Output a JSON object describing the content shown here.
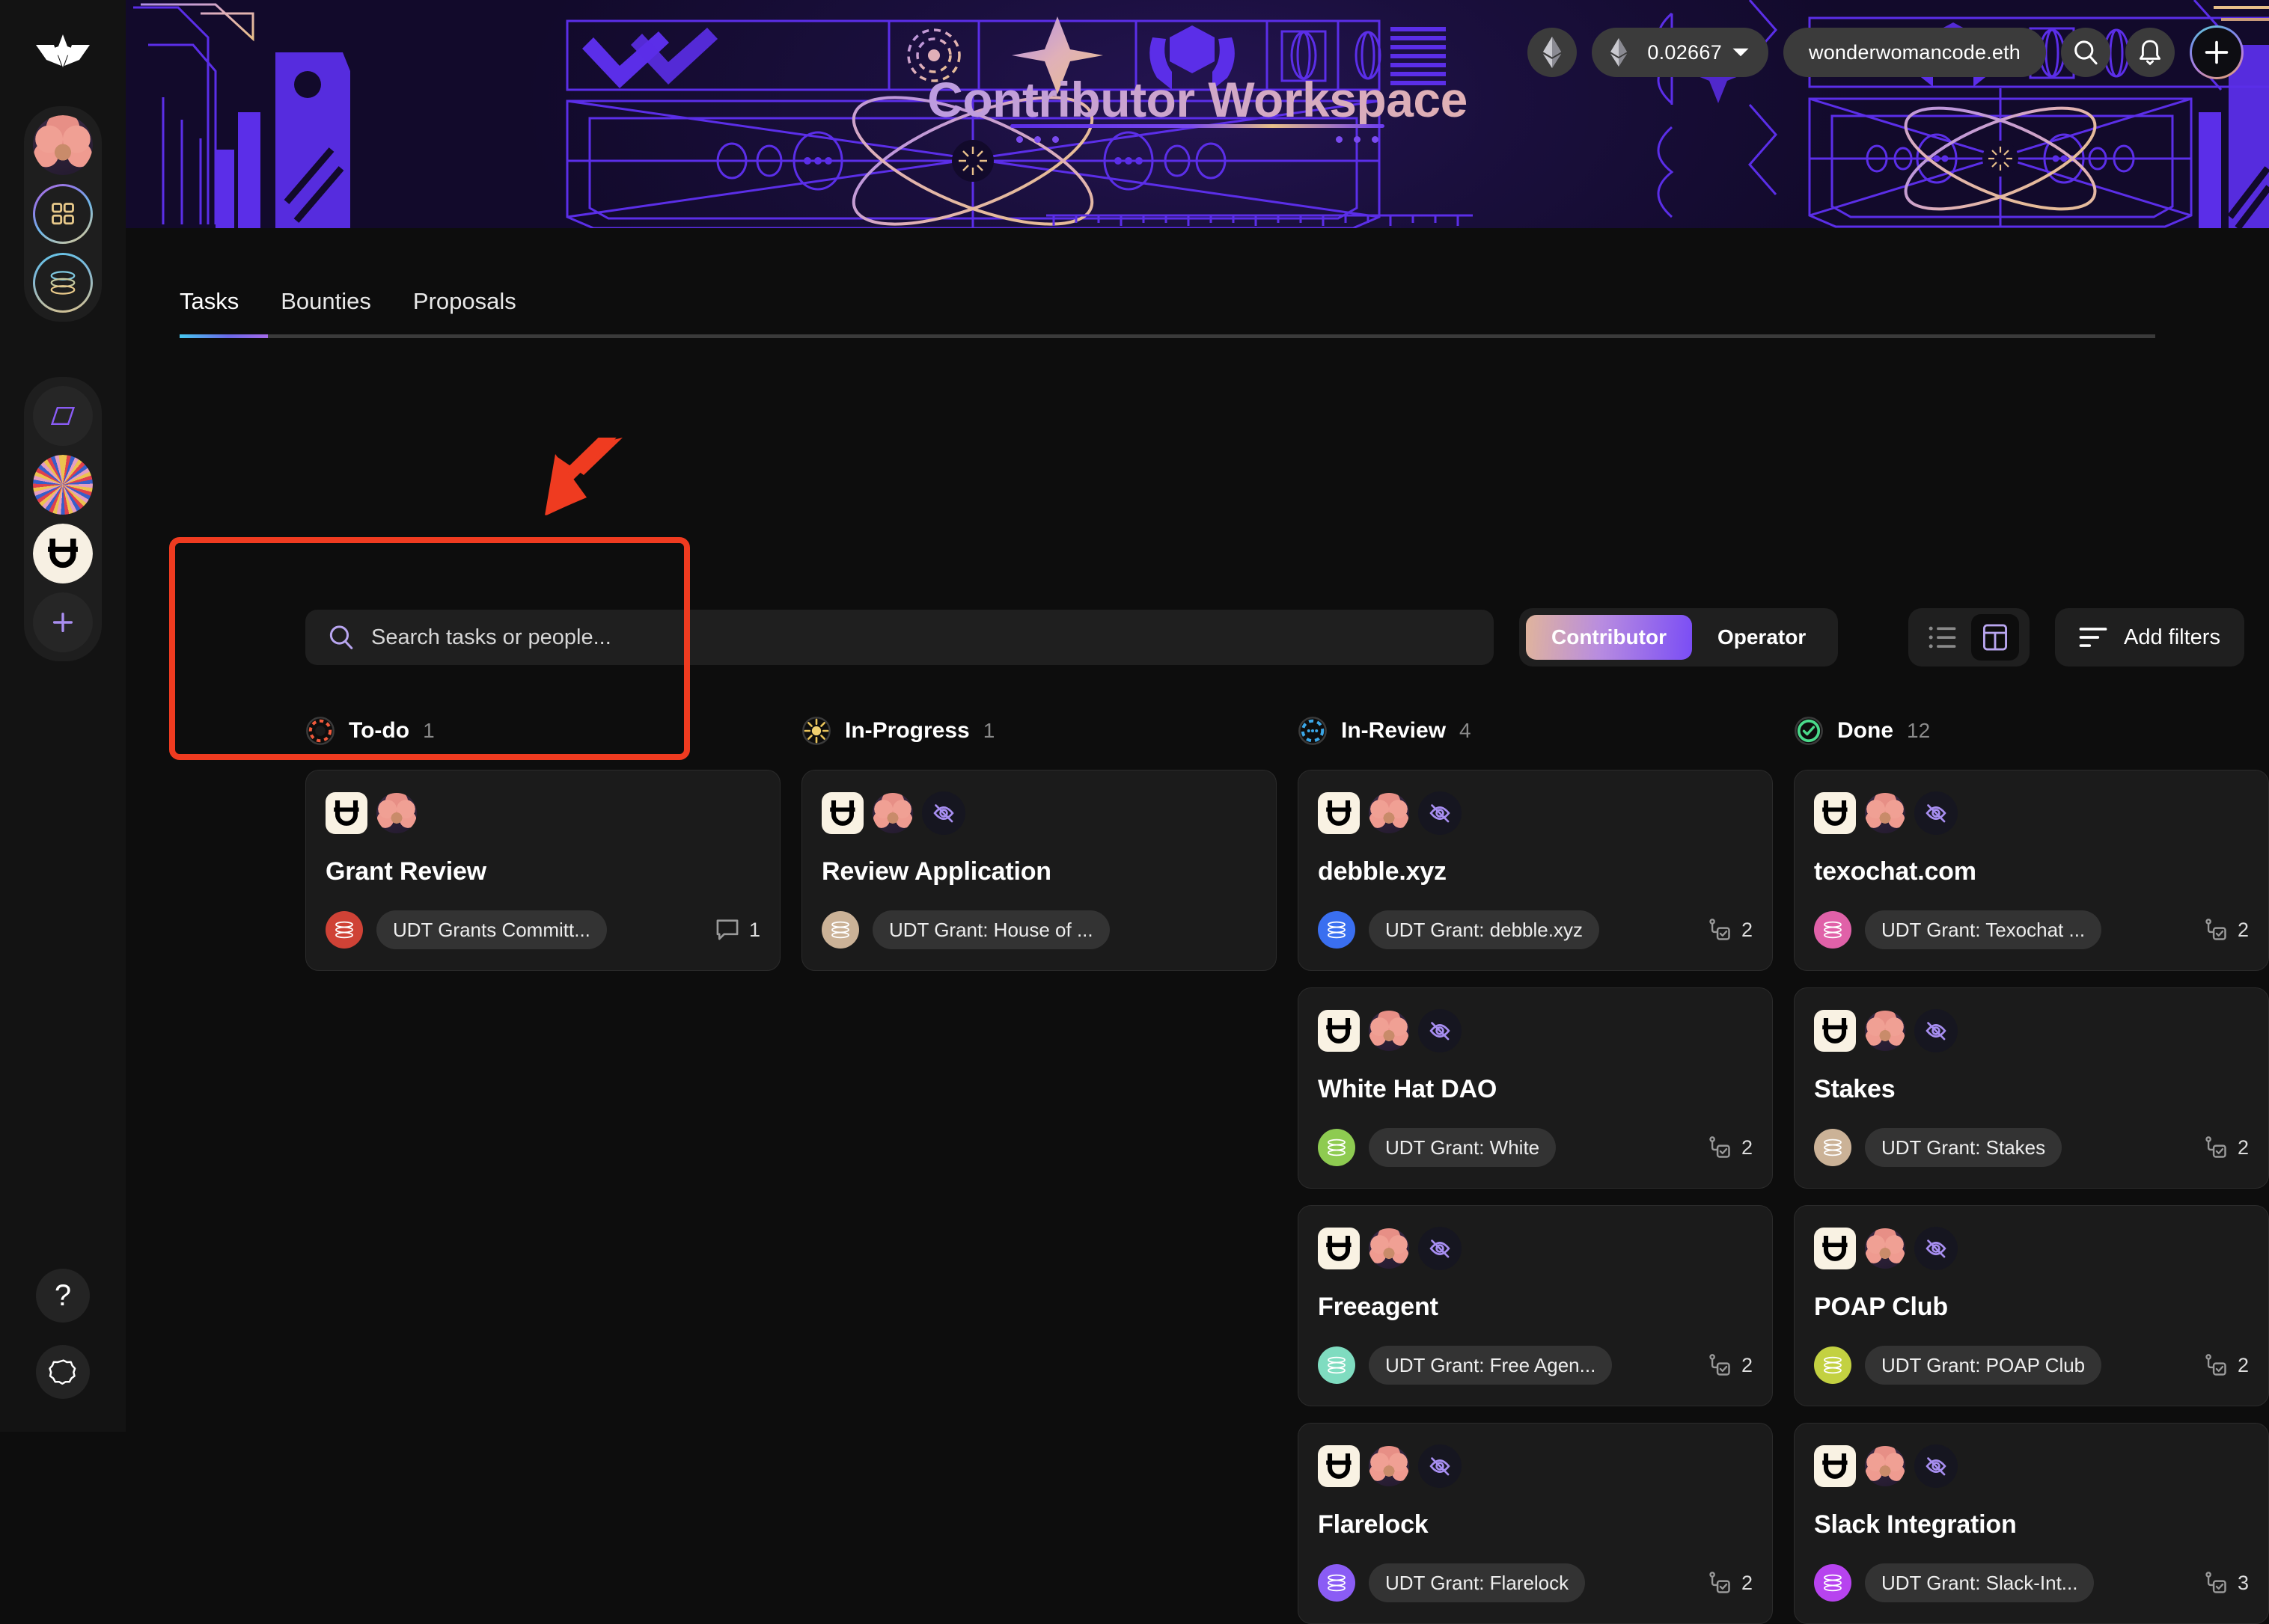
{
  "app": {
    "title": "Contributor Workspace",
    "logo_icon": "dework-logo-icon"
  },
  "rail": {
    "items": [
      {
        "name": "user-avatar",
        "icon": "avatar-icon",
        "label": ""
      },
      {
        "name": "apps-grid",
        "icon": "grid-icon",
        "label": ""
      },
      {
        "name": "workspace-stack",
        "icon": "stack-icon",
        "label": ""
      },
      {
        "name": "diamond-workspace",
        "icon": "diamond-icon",
        "label": ""
      },
      {
        "name": "nft-workspace",
        "icon": "nft-avatar-icon",
        "label": ""
      },
      {
        "name": "udt-workspace",
        "icon": "udt-logo-icon",
        "label": ""
      },
      {
        "name": "add-workspace",
        "icon": "plus-icon",
        "label": ""
      }
    ],
    "bottom": [
      {
        "name": "help",
        "icon": "question-mark-icon",
        "glyph": "?"
      },
      {
        "name": "settings",
        "icon": "gear-icon",
        "glyph": ""
      }
    ]
  },
  "header": {
    "eth_icon": "ethereum-icon",
    "balance": "0.02667",
    "balance_caret_icon": "chevron-down-icon",
    "ens_name": "wonderwomancode.eth",
    "search_icon": "search-icon",
    "notifications_icon": "bell-icon",
    "add_icon": "plus-icon"
  },
  "tabs": [
    {
      "label": "Tasks",
      "active": true
    },
    {
      "label": "Bounties",
      "active": false
    },
    {
      "label": "Proposals",
      "active": false
    }
  ],
  "toolbar": {
    "search_placeholder": "Search tasks or people...",
    "search_value": "",
    "search_icon": "search-icon",
    "roles": [
      {
        "label": "Contributor",
        "active": true
      },
      {
        "label": "Operator",
        "active": false
      }
    ],
    "views": [
      {
        "name": "list-view",
        "icon": "list-icon",
        "selected": false
      },
      {
        "name": "board-view",
        "icon": "board-icon",
        "selected": true
      }
    ],
    "filters_label": "Add filters",
    "filters_icon": "filter-icon"
  },
  "board": {
    "columns": [
      {
        "name": "todo",
        "title": "To-do",
        "count": "1",
        "status_icon": "todo-circle-icon",
        "status_color": "#f05a3c",
        "cards": [
          {
            "title": "Grant Review",
            "udt_icon": "udt-logo-icon",
            "avatar_icon": "assignee-avatar-icon",
            "eye_icon": "",
            "has_eye": false,
            "project": "UDT Grants Committ...",
            "project_color": "#cf4236",
            "meta_icon": "comment-icon",
            "meta_value": "1",
            "highlighted": true
          }
        ]
      },
      {
        "name": "in-progress",
        "title": "In-Progress",
        "count": "1",
        "status_icon": "in-progress-sun-icon",
        "status_color": "#e8c35a",
        "cards": [
          {
            "title": "Review Application",
            "udt_icon": "udt-logo-icon",
            "avatar_icon": "assignee-avatar-icon",
            "eye_icon": "eye-off-icon",
            "has_eye": true,
            "project": "UDT Grant: House of ...",
            "project_color": "#cbb297",
            "meta_icon": "",
            "meta_value": "",
            "highlighted": false
          }
        ]
      },
      {
        "name": "in-review",
        "title": "In-Review",
        "count": "4",
        "status_icon": "in-review-dots-icon",
        "status_color": "#3ba7e8",
        "cards": [
          {
            "title": "debble.xyz",
            "udt_icon": "udt-logo-icon",
            "avatar_icon": "assignee-avatar-icon",
            "eye_icon": "eye-off-icon",
            "has_eye": true,
            "project": "UDT Grant: debble.xyz",
            "project_color": "#3a6ff0",
            "meta_icon": "subtask-icon",
            "meta_value": "2",
            "highlighted": false
          },
          {
            "title": "White Hat DAO",
            "udt_icon": "udt-logo-icon",
            "avatar_icon": "assignee-avatar-icon",
            "eye_icon": "eye-off-icon",
            "has_eye": true,
            "project": "UDT Grant: White",
            "project_color": "#8ecb51",
            "meta_icon": "subtask-icon",
            "meta_value": "2",
            "highlighted": false
          },
          {
            "title": "Freeagent",
            "udt_icon": "udt-logo-icon",
            "avatar_icon": "assignee-avatar-icon",
            "eye_icon": "eye-off-icon",
            "has_eye": true,
            "project": "UDT Grant: Free Agen...",
            "project_color": "#7fdcc0",
            "meta_icon": "subtask-icon",
            "meta_value": "2",
            "highlighted": false
          },
          {
            "title": "Flarelock",
            "udt_icon": "udt-logo-icon",
            "avatar_icon": "assignee-avatar-icon",
            "eye_icon": "eye-off-icon",
            "has_eye": true,
            "project": "UDT Grant: Flarelock",
            "project_color": "#8a5cf5",
            "meta_icon": "subtask-icon",
            "meta_value": "2",
            "highlighted": false
          }
        ]
      },
      {
        "name": "done",
        "title": "Done",
        "count": "12",
        "status_icon": "done-check-icon",
        "status_color": "#4ad98a",
        "cards": [
          {
            "title": "texochat.com",
            "udt_icon": "udt-logo-icon",
            "avatar_icon": "assignee-avatar-icon",
            "eye_icon": "eye-off-icon",
            "has_eye": true,
            "project": "UDT Grant: Texochat ...",
            "project_color": "#e061a8",
            "meta_icon": "subtask-icon",
            "meta_value": "2",
            "highlighted": false
          },
          {
            "title": "Stakes",
            "udt_icon": "udt-logo-icon",
            "avatar_icon": "assignee-avatar-icon",
            "eye_icon": "eye-off-icon",
            "has_eye": true,
            "project": "UDT Grant: Stakes",
            "project_color": "#cbb297",
            "meta_icon": "subtask-icon",
            "meta_value": "2",
            "highlighted": false
          },
          {
            "title": "POAP Club",
            "udt_icon": "udt-logo-icon",
            "avatar_icon": "assignee-avatar-icon",
            "eye_icon": "eye-off-icon",
            "has_eye": true,
            "project": "UDT Grant: POAP Club",
            "project_color": "#c3d141",
            "meta_icon": "subtask-icon",
            "meta_value": "2",
            "highlighted": false
          },
          {
            "title": "Slack Integration",
            "udt_icon": "udt-logo-icon",
            "avatar_icon": "assignee-avatar-icon",
            "eye_icon": "eye-off-icon",
            "has_eye": true,
            "project": "UDT Grant: Slack-Int...",
            "project_color": "#b743ef",
            "meta_icon": "subtask-icon",
            "meta_value": "3",
            "highlighted": false
          }
        ]
      }
    ]
  },
  "annotation": {
    "arrow_icon": "red-arrow-icon",
    "arrow_color": "#ef3b20",
    "highlight_color": "#ef3b20"
  }
}
